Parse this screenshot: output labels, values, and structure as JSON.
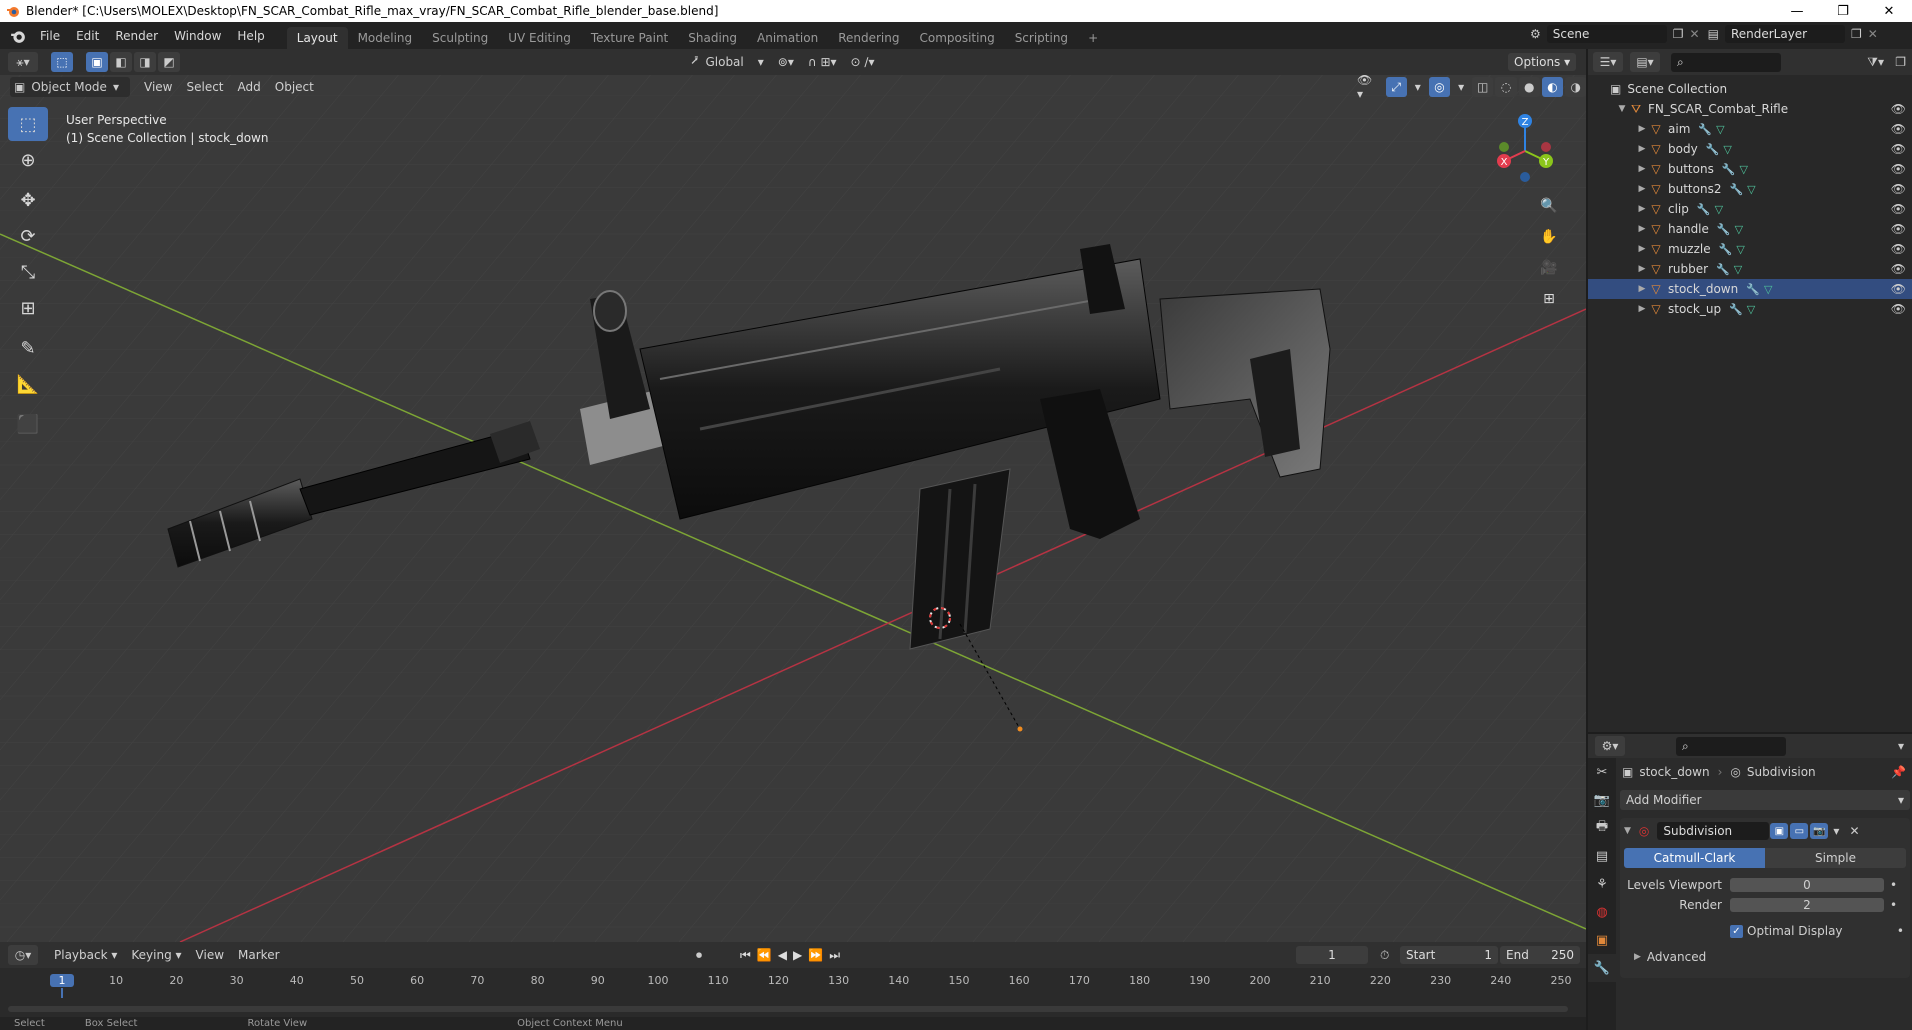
{
  "window": {
    "title": "Blender* [C:\\Users\\MOLEX\\Desktop\\FN_SCAR_Combat_Rifle_max_vray/FN_SCAR_Combat_Rifle_blender_base.blend]",
    "controls": [
      "—",
      "❐",
      "✕"
    ]
  },
  "menubar": {
    "items": [
      "File",
      "Edit",
      "Render",
      "Window",
      "Help"
    ],
    "workspaces": [
      "Layout",
      "Modeling",
      "Sculpting",
      "UV Editing",
      "Texture Paint",
      "Shading",
      "Animation",
      "Rendering",
      "Compositing",
      "Scripting"
    ],
    "active_workspace": "Layout",
    "scene": "Scene",
    "view_layer": "RenderLayer"
  },
  "viewport": {
    "transform_orientation": "Global",
    "options_label": "Options",
    "mode": "Object Mode",
    "menus": [
      "View",
      "Select",
      "Add",
      "Object"
    ],
    "info_line1": "User Perspective",
    "info_line2": "(1) Scene Collection | stock_down",
    "gizmo_axes": [
      "Z",
      "X",
      "Y"
    ]
  },
  "outliner": {
    "root": "Scene Collection",
    "collection": "FN_SCAR_Combat_Rifle",
    "objects": [
      "aim",
      "body",
      "buttons",
      "buttons2",
      "clip",
      "handle",
      "muzzle",
      "rubber",
      "stock_down",
      "stock_up"
    ],
    "active_object": "stock_down"
  },
  "properties": {
    "object": "stock_down",
    "modifier_context": "Subdivision",
    "add_modifier": "Add Modifier",
    "modifier_name": "Subdivision",
    "algorithms": [
      "Catmull-Clark",
      "Simple"
    ],
    "active_algorithm": "Catmull-Clark",
    "levels_viewport_label": "Levels Viewport",
    "levels_viewport": "0",
    "render_label": "Render",
    "render_levels": "2",
    "optimal_display": "Optimal Display",
    "advanced": "Advanced"
  },
  "timeline": {
    "menus": [
      "Playback",
      "Keying",
      "View",
      "Marker"
    ],
    "current_frame": "1",
    "start_label": "Start",
    "start": "1",
    "end_label": "End",
    "end": "250",
    "ticks": [
      "1",
      "10",
      "20",
      "30",
      "40",
      "50",
      "60",
      "70",
      "80",
      "90",
      "100",
      "110",
      "120",
      "130",
      "140",
      "150",
      "160",
      "170",
      "180",
      "190",
      "200",
      "210",
      "220",
      "230",
      "240",
      "250"
    ]
  },
  "statusbar": [
    "Select",
    "Box Select",
    "Rotate View",
    "Object Context Menu"
  ],
  "colors": {
    "accent": "#4772b3",
    "mesh_icon": "#e0883a",
    "x_axis": "#e23c4e",
    "y_axis": "#8bc51b",
    "z_axis": "#2f83e3"
  }
}
